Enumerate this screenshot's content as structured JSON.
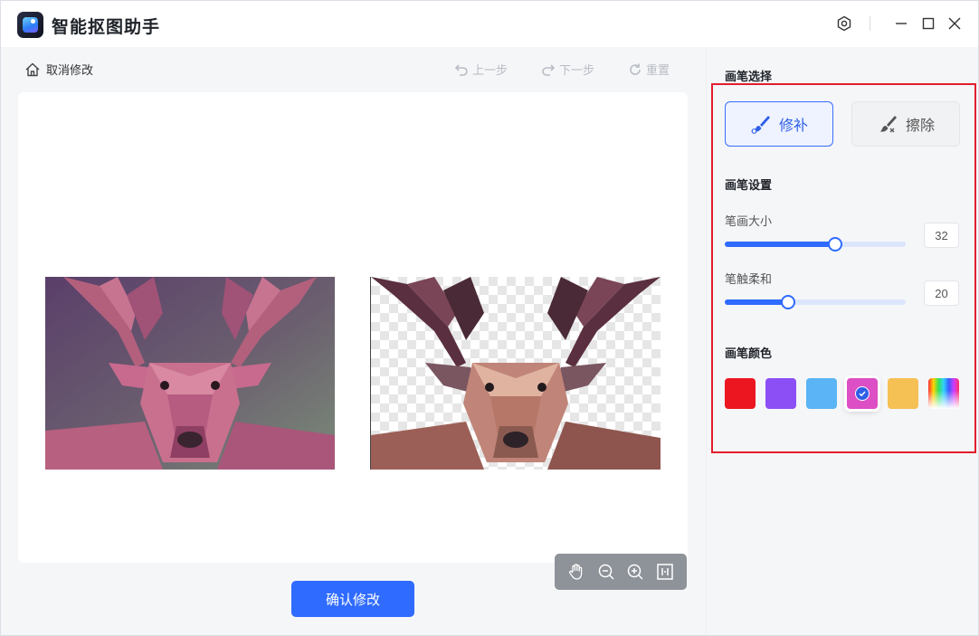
{
  "app": {
    "title": "智能抠图助手"
  },
  "toolbar": {
    "cancel_label": "取消修改",
    "undo_label": "上一步",
    "redo_label": "下一步",
    "reset_label": "重置"
  },
  "main": {
    "confirm_label": "确认修改"
  },
  "panel": {
    "brush_select_title": "画笔选择",
    "modes": [
      {
        "label": "修补",
        "active": true
      },
      {
        "label": "擦除",
        "active": false
      }
    ],
    "brush_settings_title": "画笔设置",
    "size": {
      "label": "笔画大小",
      "value": "32",
      "fraction": 0.61
    },
    "softness": {
      "label": "笔触柔和",
      "value": "20",
      "fraction": 0.35
    },
    "color_title": "画笔颜色",
    "colors": [
      "#ec1620",
      "#8c4ff5",
      "#5ab4f5",
      "#dd4fc4",
      "#f5c054",
      "rainbow"
    ],
    "selected_color_index": 3
  },
  "theme": {
    "accent": "#2f6bff",
    "highlight_frame": "#e21d2c"
  }
}
